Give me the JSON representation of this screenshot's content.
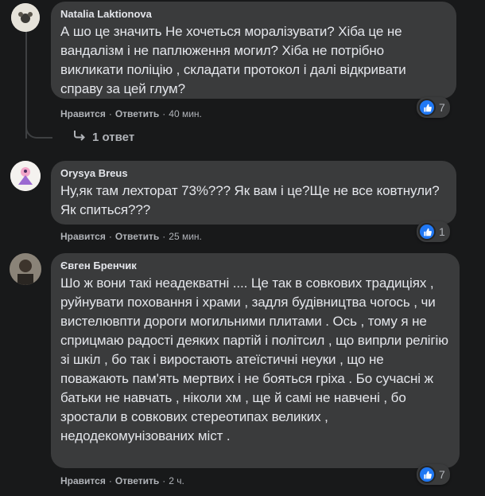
{
  "comments": [
    {
      "author": "Natalia Laktionova",
      "text": "А шо це значить Не хочеться моралізувати? Хіба це не вандалізм і не паплюження могил? Хіба не потрібно викликати поліцію , складати протокол і далі відкривати справу за цей глум?",
      "like_label": "Нравится",
      "reply_label": "Ответить",
      "time": "40 мин.",
      "reaction_count": "7",
      "replies_label": "1 ответ"
    },
    {
      "author": "Orysya Breus",
      "text": "Ну,як там лехторат 73%??? Як вам і це?Ще не все ковтнули?Як спиться???",
      "like_label": "Нравится",
      "reply_label": "Ответить",
      "time": "25 мин.",
      "reaction_count": "1"
    },
    {
      "author": "Євген Бренчик",
      "text": "Шо ж вони такі неадекватні .... Це так в совкових традиціях , руйнувати поховання і храми , задля будівництва чогось , чи вистелювпти дороги могильними плитами . Ось , тому я не сприцмаю радості деяких партій і політсил , що випрли релігію зі шкіл , бо так і виростають атеїстичні неуки , що не поважають пам'ять мертвих і не бояться гріха . Бо сучасні ж батьки не навчать , ніколи хм , ще й самі не навчені , бо зростали в совкових стереотипах великих , недодекомунізованих міст .",
      "like_label": "Нравится",
      "reply_label": "Ответить",
      "time": "2 ч.",
      "reaction_count": "7"
    }
  ],
  "colors": {
    "background": "#18191a",
    "bubble": "#3a3b3c",
    "text": "#e4e6eb",
    "secondary_text": "#b0b3b8",
    "like_blue": "#2078f4"
  },
  "icons": [
    "avatar",
    "like-icon",
    "reply-arrow-icon"
  ]
}
